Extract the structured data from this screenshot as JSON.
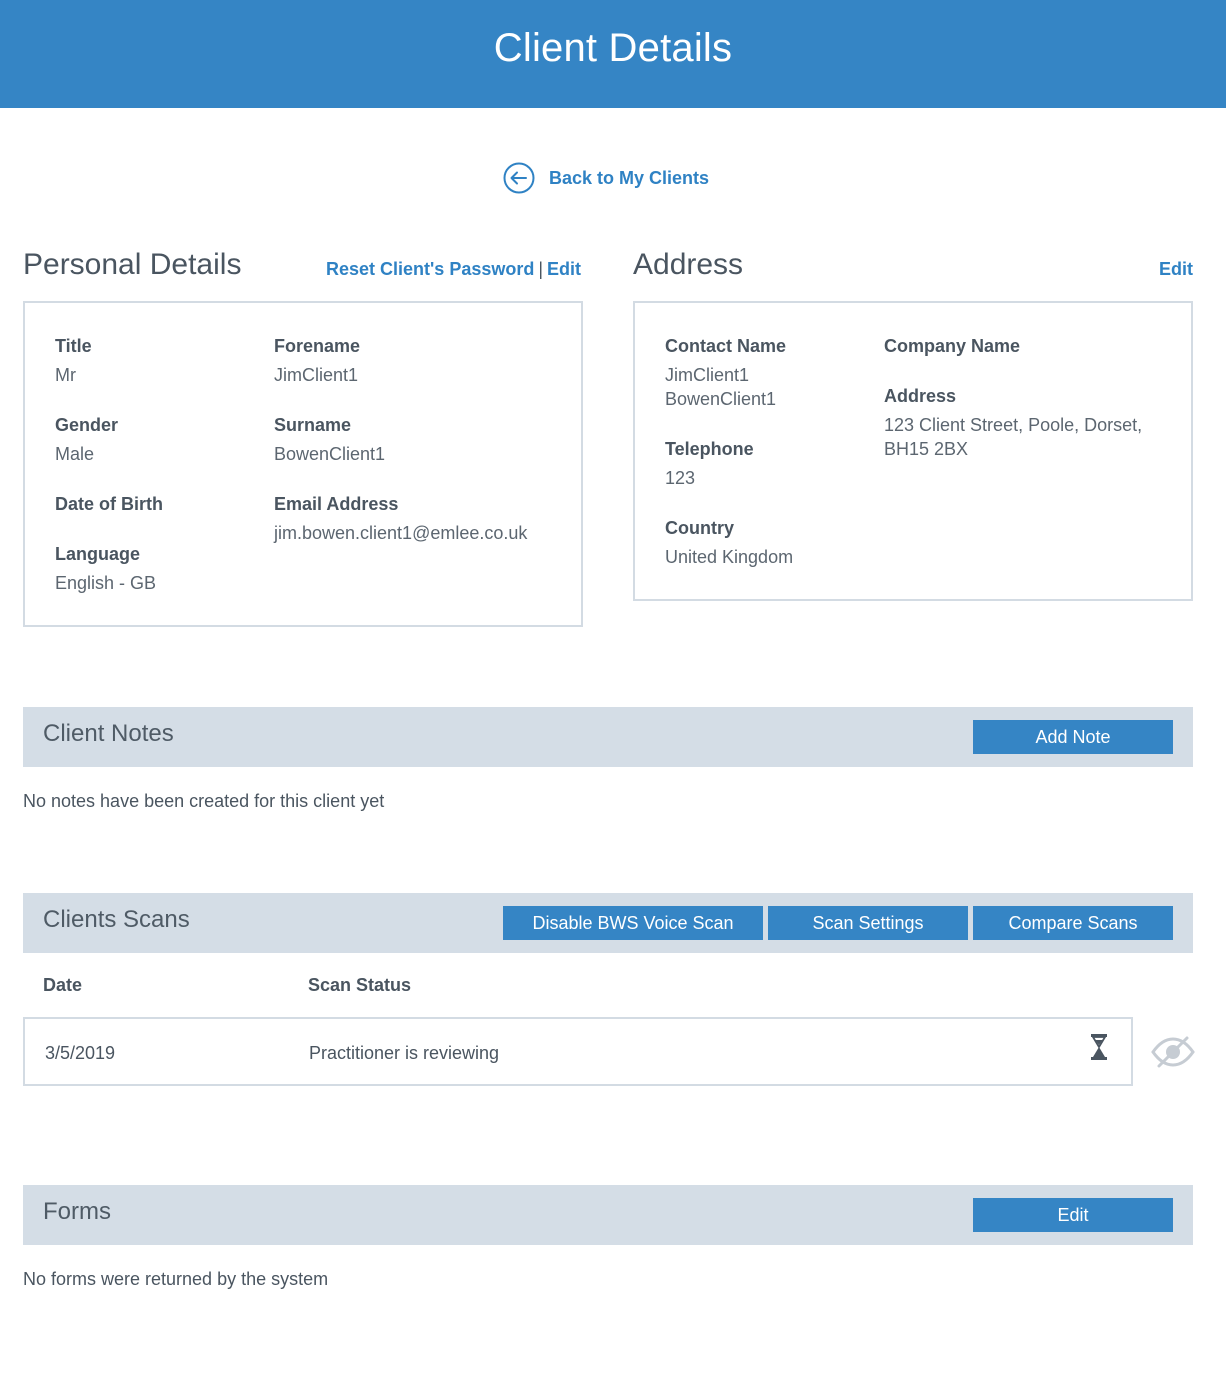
{
  "header": {
    "title": "Client Details"
  },
  "back_link": {
    "label": "Back to My Clients"
  },
  "personal": {
    "title": "Personal Details",
    "reset_password": "Reset Client's Password",
    "separator": "|",
    "edit": "Edit",
    "fields": {
      "title_label": "Title",
      "title_value": "Mr",
      "forename_label": "Forename",
      "forename_value": "JimClient1",
      "gender_label": "Gender",
      "gender_value": "Male",
      "surname_label": "Surname",
      "surname_value": "BowenClient1",
      "dob_label": "Date of Birth",
      "dob_value": "",
      "email_label": "Email Address",
      "email_value": "jim.bowen.client1@emlee.co.uk",
      "language_label": "Language",
      "language_value": "English - GB"
    }
  },
  "address": {
    "title": "Address",
    "edit": "Edit",
    "fields": {
      "contact_label": "Contact Name",
      "contact_line1": "JimClient1",
      "contact_line2": "BowenClient1",
      "company_label": "Company Name",
      "company_value": "",
      "address_label": "Address",
      "address_line1": "123 Client Street, Poole, Dorset,",
      "address_line2": "BH15 2BX",
      "telephone_label": "Telephone",
      "telephone_value": "123",
      "country_label": "Country",
      "country_value": "United Kingdom"
    }
  },
  "notes": {
    "title": "Client Notes",
    "add_button": "Add Note",
    "empty": "No notes have been created for this client yet"
  },
  "scans": {
    "title": "Clients Scans",
    "buttons": {
      "disable": "Disable BWS Voice Scan",
      "settings": "Scan Settings",
      "compare": "Compare Scans"
    },
    "columns": {
      "date": "Date",
      "status": "Scan Status"
    },
    "rows": [
      {
        "date": "3/5/2019",
        "status": "Practitioner is reviewing",
        "status_icon": "hourglass-icon"
      }
    ]
  },
  "forms": {
    "title": "Forms",
    "edit_button": "Edit",
    "empty": "No forms were returned by the system"
  },
  "colors": {
    "primary": "#3585c5",
    "link": "#2f82c4",
    "band": "#d4dde6",
    "border": "#d3dbe3"
  }
}
